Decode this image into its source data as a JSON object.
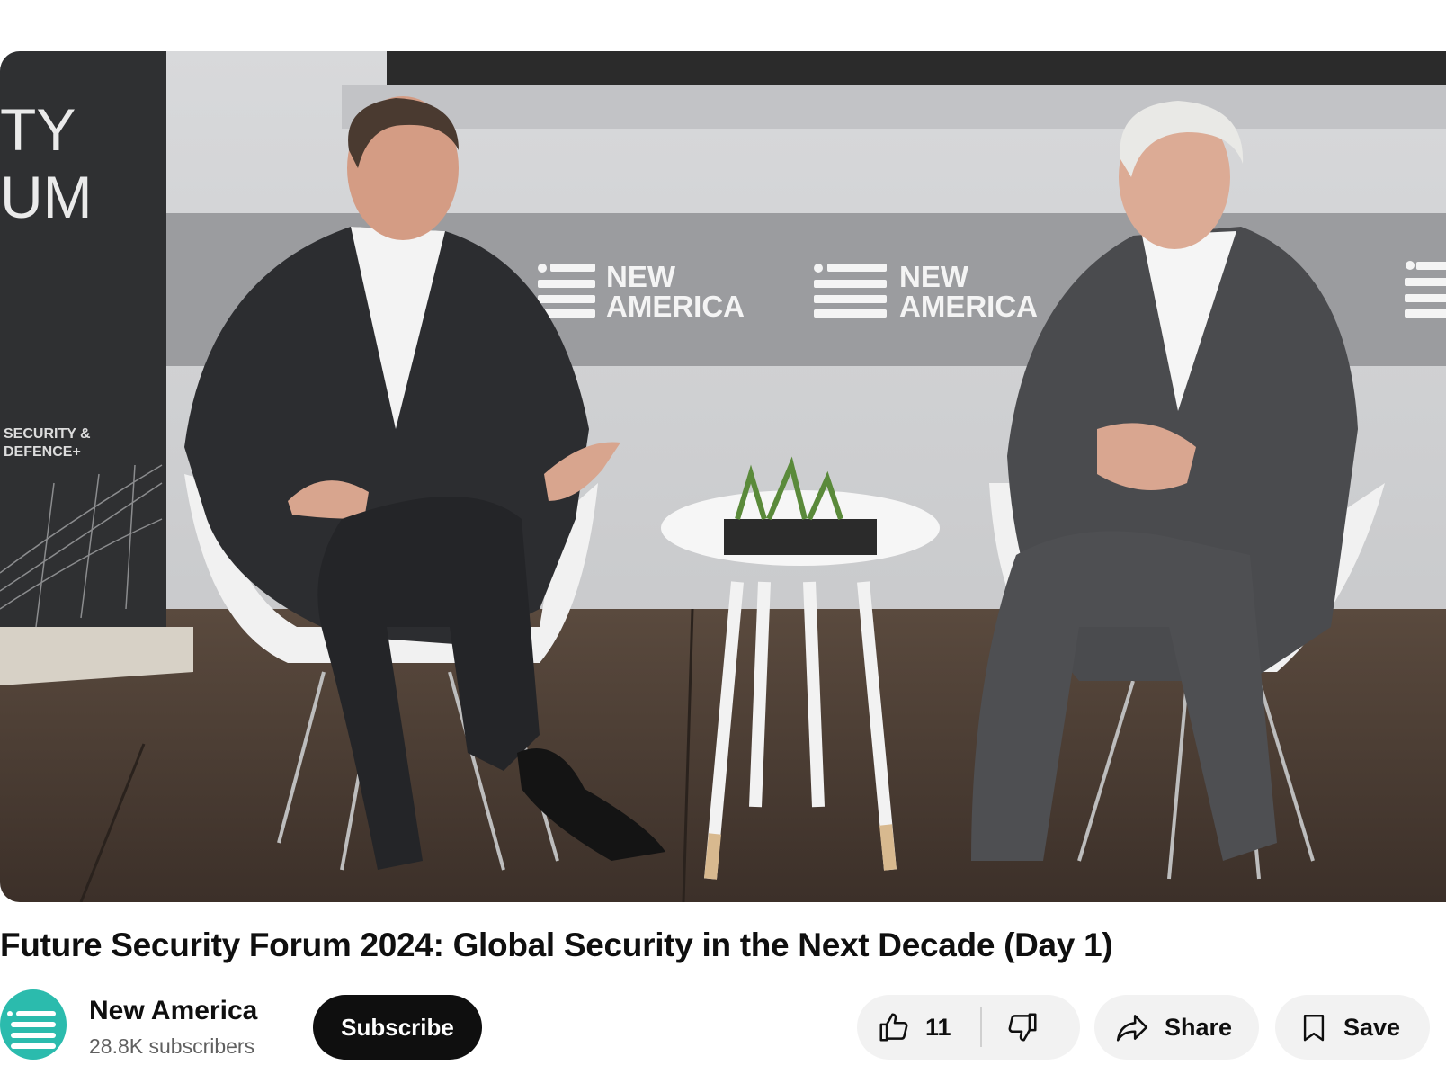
{
  "video": {
    "title": "Future Security Forum 2024: Global Security in the Next Decade (Day 1)",
    "backdrop_brand_line1": "NEW",
    "backdrop_brand_line2": "AMERICA",
    "banner_text_1": "TY",
    "banner_text_2": "UM",
    "banner_text_3": "SECURITY &",
    "banner_text_4": "DEFENCE+"
  },
  "channel": {
    "name": "New America",
    "subscribers": "28.8K subscribers",
    "avatar_color": "#2bbbad"
  },
  "actions": {
    "subscribe_label": "Subscribe",
    "like_count": "11",
    "share_label": "Share",
    "save_label": "Save"
  },
  "icons": {
    "like": "thumbs-up-icon",
    "dislike": "thumbs-down-icon",
    "share": "share-arrow-icon",
    "save": "bookmark-icon"
  }
}
